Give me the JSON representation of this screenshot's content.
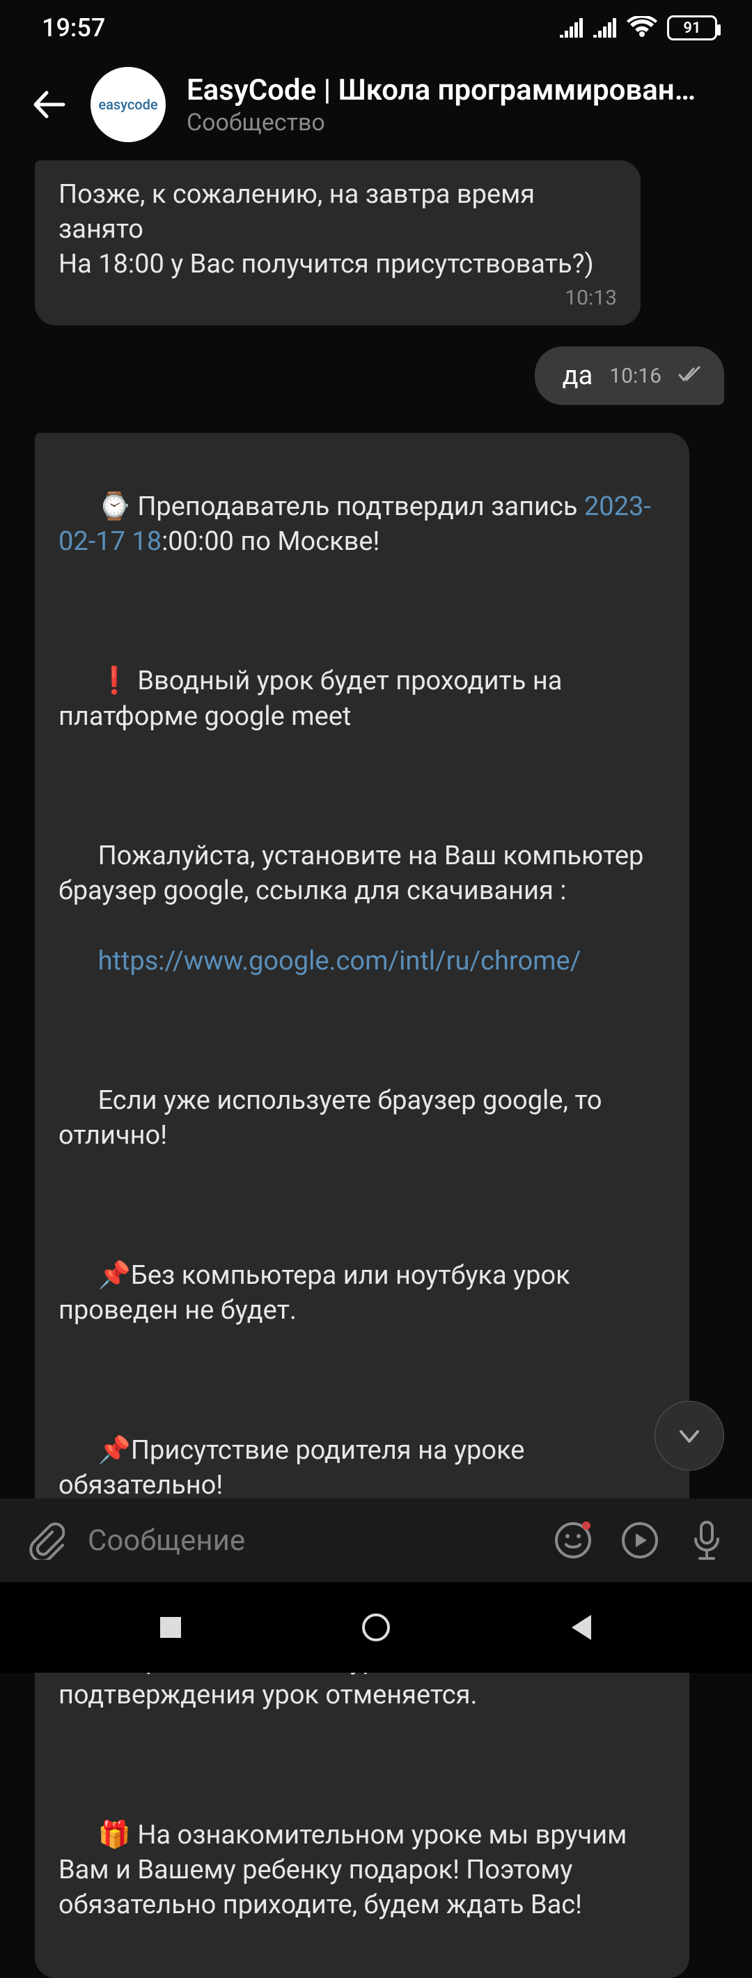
{
  "status": {
    "time": "19:57",
    "battery": "91"
  },
  "header": {
    "title": "EasyCode | Школа программирован…",
    "subtitle": "Сообщество",
    "avatar_text": "easycode"
  },
  "messages": {
    "m1": {
      "text": "Позже, к сожалению, на завтра время занято\nНа 18:00 у Вас получится присутствовать?)",
      "time": "10:13"
    },
    "m2": {
      "text": "да",
      "time": "10:16"
    },
    "m3": {
      "emoji_watch": "⌚",
      "line1a": " Преподаватель подтвердил запись ",
      "datetime_link": "2023-02-17 18",
      "line1b": ":00:00 по Москве!",
      "emoji_exclaim": "❗",
      "line2": " Вводный урок будет проходить на платформе google meet",
      "line3": "Пожалуйста, установите на Ваш компьютер браузер google, ссылка для скачивания :",
      "chrome_link": "https://www.google.com/intl/ru/chrome/",
      "line4": "Если уже используете браузер google, то отлично!",
      "emoji_pin": "📌",
      "pin1": "Без компьютера или ноутбука урок проведен не будет.",
      "pin2": "Присутствие родителя на уроке обязательно!",
      "pin3": "Я напишу Вас завтра за час до урока для подтверждения в день урока. Без подтверждения урок отменяется.",
      "emoji_gift": "🎁",
      "gift_text": " На ознакомительном уроке мы вручим Вам и Вашему ребенку подарок! Поэтому обязательно приходите, будем ждать Вас!"
    }
  },
  "input": {
    "placeholder": "Сообщение"
  }
}
